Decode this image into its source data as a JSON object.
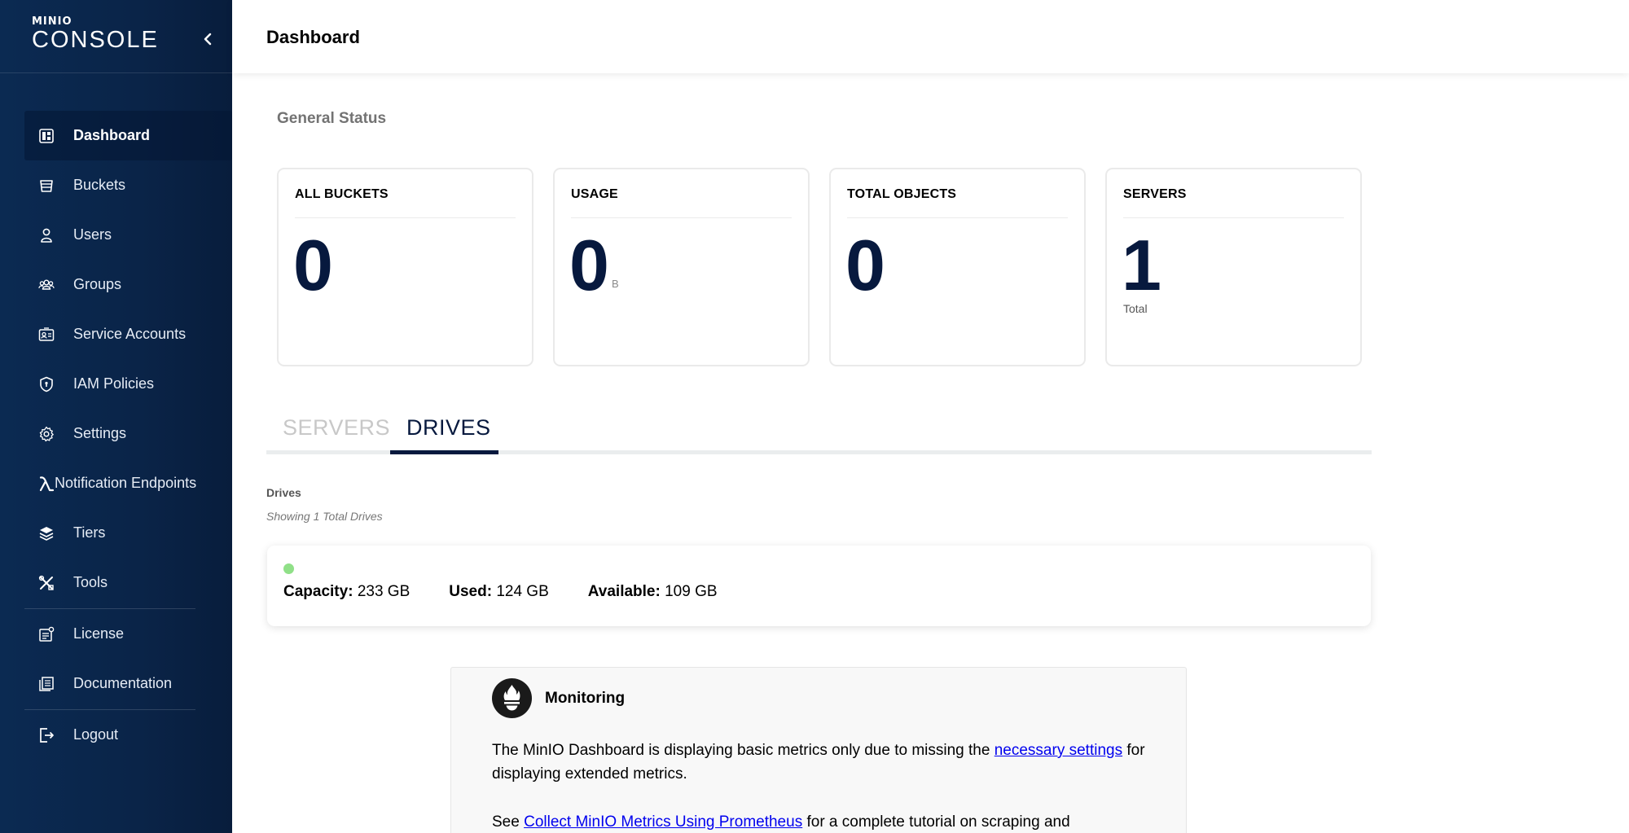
{
  "sidebar": {
    "logo_small": "MINIO",
    "logo_big": "CONSOLE",
    "collapse_icon": "chevron-left-icon",
    "items": [
      {
        "label": "Dashboard",
        "icon": "dashboard-icon",
        "active": true
      },
      {
        "label": "Buckets",
        "icon": "bucket-icon"
      },
      {
        "label": "Users",
        "icon": "user-icon"
      },
      {
        "label": "Groups",
        "icon": "groups-icon"
      },
      {
        "label": "Service Accounts",
        "icon": "id-card-icon"
      },
      {
        "label": "IAM Policies",
        "icon": "shield-icon"
      },
      {
        "label": "Settings",
        "icon": "gear-icon"
      },
      {
        "label": "Notification Endpoints",
        "icon": "lambda-icon"
      },
      {
        "label": "Tiers",
        "icon": "layers-icon"
      },
      {
        "label": "Tools",
        "icon": "tools-icon"
      },
      {
        "label": "License",
        "icon": "license-icon"
      },
      {
        "label": "Documentation",
        "icon": "documentation-icon"
      },
      {
        "label": "Logout",
        "icon": "logout-icon"
      }
    ]
  },
  "header": {
    "title": "Dashboard"
  },
  "main": {
    "section_title": "General Status",
    "cards": [
      {
        "title": "ALL BUCKETS",
        "value": "0",
        "unit": "",
        "sub": ""
      },
      {
        "title": "USAGE",
        "value": "0",
        "unit": "B",
        "sub": ""
      },
      {
        "title": "TOTAL OBJECTS",
        "value": "0",
        "unit": "",
        "sub": ""
      },
      {
        "title": "SERVERS",
        "value": "1",
        "unit": "",
        "sub": "Total"
      }
    ],
    "tabs": [
      {
        "label": "SERVERS",
        "active": false
      },
      {
        "label": "DRIVES",
        "active": true
      }
    ],
    "drives": {
      "label": "Drives",
      "subtitle": "Showing 1 Total Drives",
      "status_color": "#90e088",
      "capacity_label": "Capacity:",
      "capacity": "233 GB",
      "used_label": "Used:",
      "used": "124 GB",
      "available_label": "Available:",
      "available": "109 GB"
    },
    "monitoring": {
      "icon": "prometheus-icon",
      "title": "Monitoring",
      "text1_pre": "The MinIO Dashboard is displaying basic metrics only due to missing the ",
      "text1_link": "necessary settings",
      "text1_post": " for displaying extended metrics.",
      "text2_pre": "See ",
      "text2_link": "Collect MinIO Metrics Using Prometheus",
      "text2_post": " for a complete tutorial on scraping and"
    }
  },
  "colors": {
    "sidebar_bg": "#0a2448",
    "accent": "#07193e",
    "status_ok": "#90e088",
    "link": "#0000ee"
  }
}
